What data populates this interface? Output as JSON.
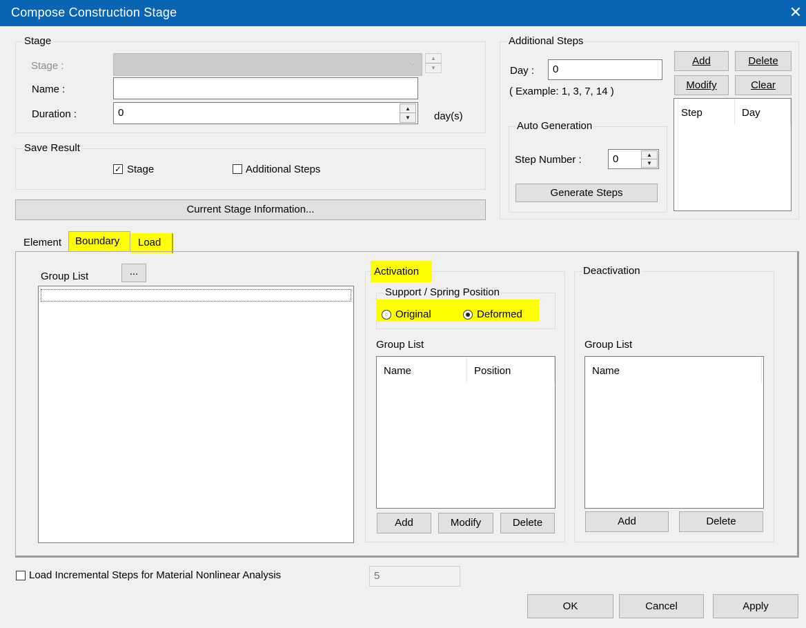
{
  "window": {
    "title": "Compose Construction Stage",
    "close_glyph": "✕"
  },
  "stage_group": {
    "label": "Stage",
    "stage_label": "Stage :",
    "stage_value": "",
    "name_label": "Name :",
    "name_value": "",
    "duration_label": "Duration :",
    "duration_value": "0",
    "duration_unit": "day(s)"
  },
  "save_result": {
    "label": "Save Result",
    "stage_checkbox": {
      "label": "Stage",
      "checked": true,
      "mark": "✓"
    },
    "additional_steps_checkbox": {
      "label": "Additional Steps",
      "checked": false
    }
  },
  "current_stage_button": "Current Stage Information...",
  "additional_steps": {
    "label": "Additional Steps",
    "day_label": "Day :",
    "day_value": "0",
    "example": "( Example: 1, 3, 7, 14  )",
    "buttons": {
      "add": "Add",
      "delete": "Delete",
      "modify": "Modify",
      "clear": "Clear"
    },
    "columns": [
      "Step",
      "Day"
    ],
    "auto_generation": {
      "label": "Auto Generation",
      "step_number_label": "Step Number  :",
      "step_number_value": "0",
      "generate_button": "Generate Steps"
    }
  },
  "tabs": [
    {
      "label": "Element",
      "highlighted": false
    },
    {
      "label": "Boundary",
      "highlighted": true,
      "active": true
    },
    {
      "label": "Load",
      "highlighted": true
    }
  ],
  "boundary_tab": {
    "group_list_label": "Group List",
    "ellipsis_button": "...",
    "activation": {
      "label": "Activation",
      "support_spring_label": "Support / Spring Position",
      "original_label": "Original",
      "deformed_label": "Deformed",
      "selected": "Deformed",
      "group_list_label": "Group List",
      "columns": [
        "Name",
        "Position"
      ],
      "buttons": {
        "add": "Add",
        "modify": "Modify",
        "delete": "Delete"
      }
    },
    "deactivation": {
      "label": "Deactivation",
      "group_list_label": "Group List",
      "columns": [
        "Name"
      ],
      "buttons": {
        "add": "Add",
        "delete": "Delete"
      }
    }
  },
  "load_incremental": {
    "label": "Load Incremental Steps for Material Nonlinear Analysis",
    "checked": false,
    "value": "5"
  },
  "footer": {
    "ok": "OK",
    "cancel": "Cancel",
    "apply": "Apply"
  },
  "colors": {
    "titlebar": "#0a64b4",
    "highlight": "#ffff00",
    "dialog_bg": "#f0f0f0"
  },
  "icons": {
    "close": "close-icon",
    "spin": "spin-arrows-icon",
    "check": "checkmark-icon",
    "dropdown": "chevron-down-icon"
  }
}
